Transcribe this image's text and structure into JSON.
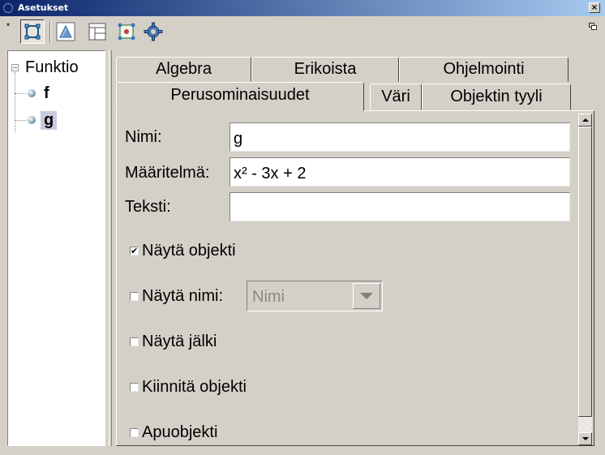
{
  "window": {
    "title": "Asetukset",
    "close_glyph": "×"
  },
  "toolbar": {
    "menu_glyph": "▾",
    "buttons": [
      {
        "icon": "object-settings-icon",
        "active": true
      },
      {
        "icon": "graphics-view-icon",
        "active": false
      },
      {
        "icon": "layout-icon",
        "active": false
      },
      {
        "icon": "defaults-icon",
        "active": false
      },
      {
        "icon": "advanced-gear-icon",
        "active": false
      }
    ]
  },
  "tree": {
    "root_label": "Funktio",
    "collapse_glyph": "−",
    "items": [
      {
        "label": "f",
        "selected": false
      },
      {
        "label": "g",
        "selected": true
      }
    ]
  },
  "tabs": {
    "row1": [
      "Algebra",
      "Erikoista",
      "Ohjelmointi"
    ],
    "row2": [
      "Perusominaisuudet",
      "Väri",
      "Objektin tyyli"
    ],
    "active": "Perusominaisuudet"
  },
  "form": {
    "name_label": "Nimi:",
    "name_value": "g",
    "definition_label": "Määritelmä:",
    "definition_value": "x² - 3x + 2",
    "caption_label": "Teksti:",
    "caption_value": "",
    "show_object_label": "Näytä objekti",
    "show_object_checked": true,
    "show_label_label": "Näytä nimi:",
    "show_label_checked": false,
    "label_mode_value": "Nimi",
    "show_trace_label": "Näytä jälki",
    "show_trace_checked": false,
    "fix_object_label": "Kiinnitä objekti",
    "fix_object_checked": false,
    "auxiliary_label": "Apuobjekti",
    "auxiliary_checked": false,
    "check_glyph": "✔"
  },
  "colors": {
    "titlebar_start": "#0a246a",
    "titlebar_end": "#a6caf0",
    "window_bg": "#d4d0c8",
    "selection": "#c9c9e0"
  }
}
